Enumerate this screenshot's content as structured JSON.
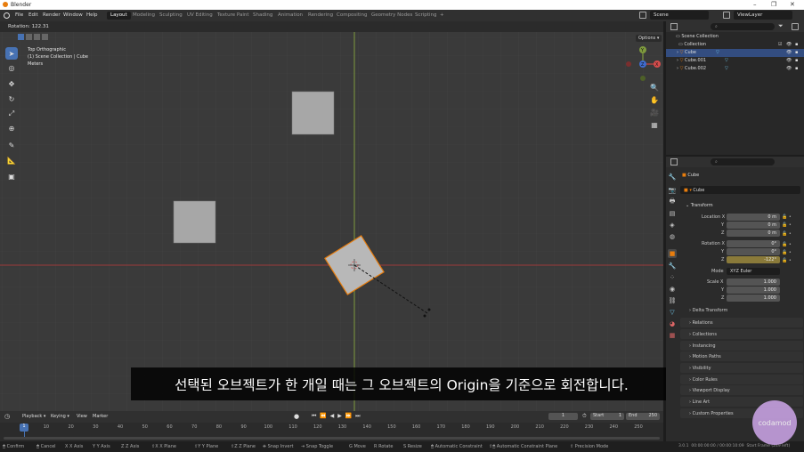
{
  "window": {
    "title": "Blender",
    "min": "–",
    "max": "❐",
    "close": "✕"
  },
  "menus": [
    "File",
    "Edit",
    "Render",
    "Window",
    "Help"
  ],
  "workspaces": [
    "Layout",
    "Modeling",
    "Sculpting",
    "UV Editing",
    "Texture Paint",
    "Shading",
    "Animation",
    "Rendering",
    "Compositing",
    "Geometry Nodes",
    "Scripting",
    "+"
  ],
  "header_right": {
    "scene": "Scene",
    "view_layer": "ViewLayer"
  },
  "viewport": {
    "header": "Rotation: 122.31",
    "info_lines": [
      "Top Orthographic",
      "(1) Scene Collection | Cube",
      "Meters"
    ],
    "options": "Options ▾",
    "gizmo": {
      "y": "Y",
      "x": "X",
      "z": "Z"
    },
    "colors": {
      "bg": "#3a3a3a",
      "x_axis": "#9c3b3b",
      "y_axis": "#7e9a3d",
      "cube": "#a7a7a7",
      "selected": "#e87d0d"
    }
  },
  "subtitle": "선택된 오브젝트가 한 개일 때는 그 오브젝트의 Origin을 기준으로 회전합니다.",
  "outliner": {
    "root": "Scene Collection",
    "items": [
      {
        "name": "Collection",
        "selected": false
      },
      {
        "name": "Cube",
        "selected": true
      },
      {
        "name": "Cube.001",
        "selected": false
      },
      {
        "name": "Cube.002",
        "selected": false
      }
    ]
  },
  "properties": {
    "object_name": "Cube",
    "data_name": "Cube",
    "transform_title": "Transform",
    "location_label": "Location X",
    "location": [
      "0 m",
      "0 m",
      "0 m"
    ],
    "rotation_label": "Rotation X",
    "rotation": [
      "0°",
      "0°",
      "-122°"
    ],
    "mode_label": "Mode",
    "mode": "XYZ Euler",
    "scale_label": "Scale X",
    "scale": [
      "1.000",
      "1.000",
      "1.000"
    ],
    "axis_labels": [
      "Y",
      "Z"
    ],
    "delta": "Delta Transform",
    "panels": [
      "Relations",
      "Collections",
      "Instancing",
      "Motion Paths",
      "Visibility",
      "Color Rules",
      "Viewport Display",
      "Line Art",
      "Custom Properties"
    ]
  },
  "timeline": {
    "menus": [
      "Playback ▾",
      "Keying ▾",
      "View",
      "Marker"
    ],
    "current_frame": "1",
    "start_label": "Start",
    "start": "1",
    "end_label": "End",
    "end": "250",
    "ticks": [
      "1",
      "10",
      "20",
      "30",
      "40",
      "50",
      "60",
      "70",
      "80",
      "90",
      "100",
      "110",
      "120",
      "130",
      "140",
      "150",
      "160",
      "170",
      "180",
      "190",
      "200",
      "210",
      "220",
      "230",
      "240",
      "250"
    ]
  },
  "status_bar": {
    "items": [
      "Confirm",
      "Cancel",
      "X Axis",
      "Y Axis",
      "Z Axis",
      "X Plane",
      "Y Plane",
      "Z Plane",
      "Snap Invert",
      "Snap Toggle",
      "Move",
      "Rotate",
      "Resize",
      "Automatic Constraint",
      "Automatic Constraint Plane",
      "Precision Mode"
    ],
    "version": "3.0.1",
    "time": "00:00:00:00 / 00:00:10:09",
    "start_frame": "Start Frame (249 left)"
  },
  "watermark": "codamod"
}
